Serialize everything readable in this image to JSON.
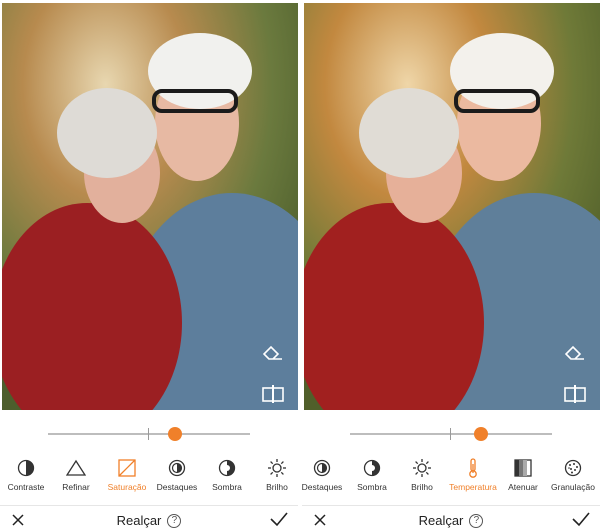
{
  "panels": [
    {
      "slider": {
        "value": 0.63
      },
      "tools": [
        {
          "label": "Contraste",
          "icon": "contrast-icon",
          "active": false
        },
        {
          "label": "Refinar",
          "icon": "triangle-icon",
          "active": false
        },
        {
          "label": "Saturação",
          "icon": "saturation-icon",
          "active": true
        },
        {
          "label": "Destaques",
          "icon": "highlights-icon",
          "active": false
        },
        {
          "label": "Sombra",
          "icon": "shadow-icon",
          "active": false
        },
        {
          "label": "Brilho",
          "icon": "sun-icon",
          "active": false
        }
      ],
      "bottombar": {
        "title": "Realçar",
        "help": "?"
      }
    },
    {
      "slider": {
        "value": 0.65
      },
      "tools": [
        {
          "label": "Destaques",
          "icon": "highlights-icon",
          "active": false
        },
        {
          "label": "Sombra",
          "icon": "shadow-icon",
          "active": false
        },
        {
          "label": "Brilho",
          "icon": "sun-icon",
          "active": false
        },
        {
          "label": "Temperatura",
          "icon": "thermometer-icon",
          "active": true
        },
        {
          "label": "Atenuar",
          "icon": "fade-icon",
          "active": false
        },
        {
          "label": "Granulação",
          "icon": "grain-icon",
          "active": false
        }
      ],
      "bottombar": {
        "title": "Realçar",
        "help": "?"
      }
    }
  ],
  "colors": {
    "accent": "#f0802a",
    "text": "#333333",
    "track": "#bdbdbd"
  }
}
